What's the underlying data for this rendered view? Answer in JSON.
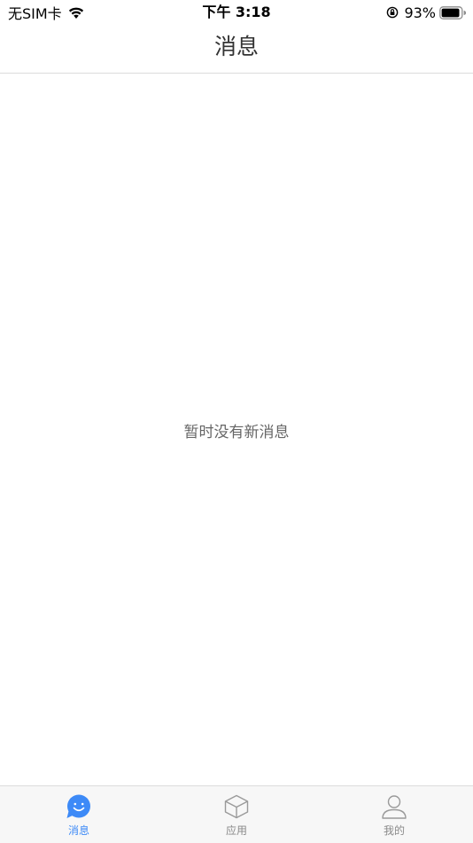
{
  "status_bar": {
    "carrier": "无SIM卡",
    "time": "下午 3:18",
    "battery_percent": "93%",
    "battery_level": 0.93
  },
  "nav": {
    "title": "消息"
  },
  "content": {
    "empty_message": "暂时没有新消息"
  },
  "tab_bar": {
    "tabs": [
      {
        "label": "消息",
        "icon": "chat-smile-icon",
        "active": true
      },
      {
        "label": "应用",
        "icon": "cube-icon",
        "active": false
      },
      {
        "label": "我的",
        "icon": "person-icon",
        "active": false
      }
    ]
  },
  "colors": {
    "accent": "#3d8af7",
    "inactive": "#8a8a8a",
    "title": "#333333"
  }
}
